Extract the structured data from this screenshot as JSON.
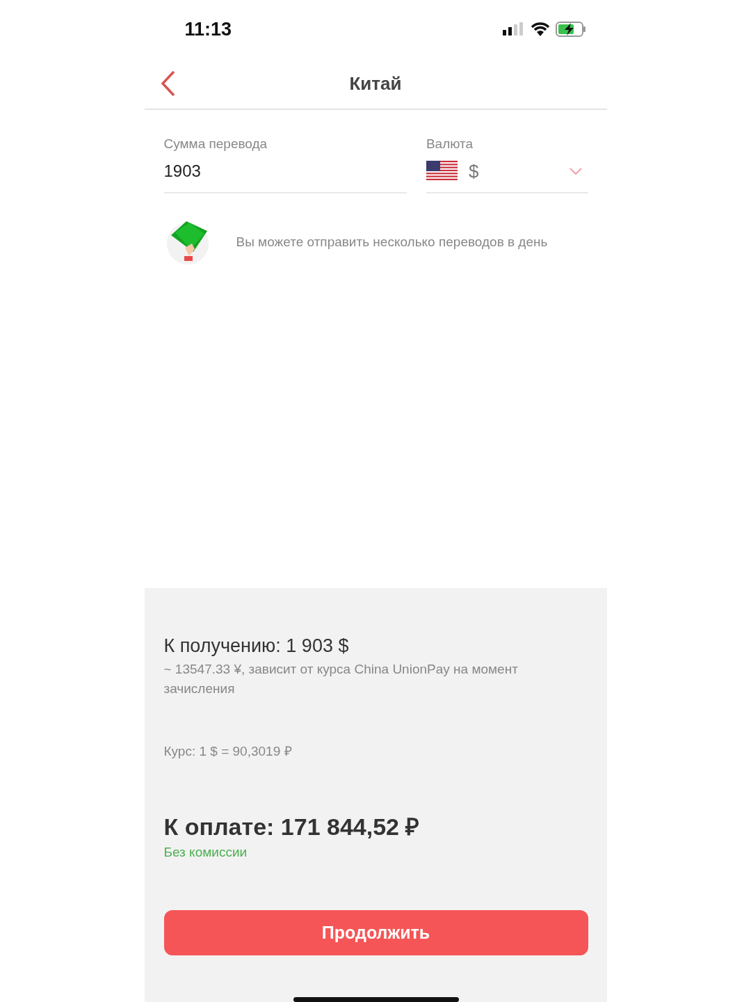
{
  "status_bar": {
    "time": "11:13"
  },
  "nav": {
    "title": "Китай"
  },
  "amount_field": {
    "label": "Сумма перевода",
    "value": "1903"
  },
  "currency_field": {
    "label": "Валюта",
    "value": "$"
  },
  "info": {
    "text": "Вы можете отправить несколько переводов в день"
  },
  "summary": {
    "receive": "К получению: 1 903 $",
    "receive_note": "~ 13547.33 ¥, зависит от курса China UnionPay на момент зачисления",
    "rate": "Курс: 1 $ = 90,3019 ₽",
    "total": "К оплате: 171 844,52 ₽",
    "fee": "Без комиссии"
  },
  "continue_button": {
    "label": "Продолжить"
  }
}
